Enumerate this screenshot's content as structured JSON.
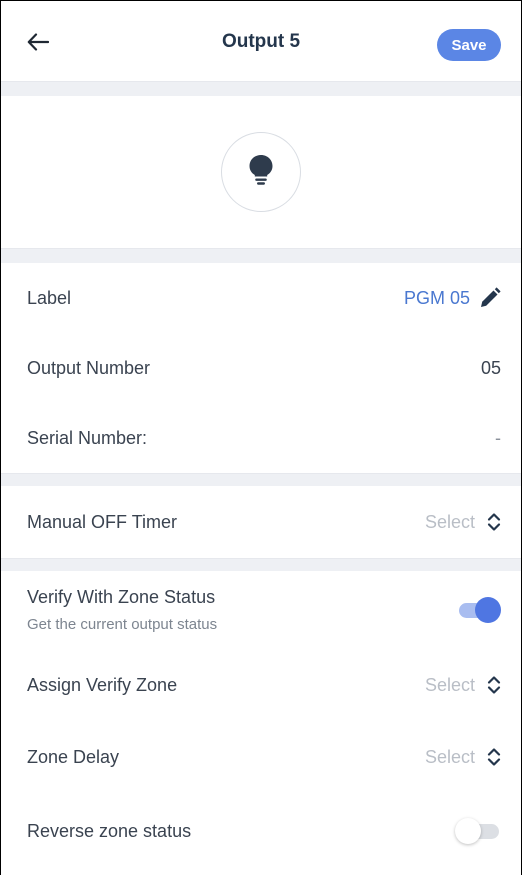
{
  "header": {
    "title": "Output 5",
    "save_label": "Save",
    "back_icon": "arrow-left-icon"
  },
  "output_icon": "lightbulb-icon",
  "fields": {
    "label": {
      "label": "Label",
      "value": "PGM 05",
      "icon": "pencil-icon"
    },
    "output_number": {
      "label": "Output Number",
      "value": "05"
    },
    "serial_number": {
      "label": "Serial Number:",
      "value": "-"
    },
    "manual_off_timer": {
      "label": "Manual OFF Timer",
      "value": "Select"
    },
    "verify_zone_status": {
      "label": "Verify With Zone Status",
      "sublabel": "Get the current output status",
      "enabled": true
    },
    "assign_verify_zone": {
      "label": "Assign Verify Zone",
      "value": "Select"
    },
    "zone_delay": {
      "label": "Zone Delay",
      "value": "Select"
    },
    "reverse_zone_status": {
      "label": "Reverse zone status",
      "enabled": false
    }
  },
  "colors": {
    "accent": "#5b86e5",
    "link": "#4a78d0",
    "muted": "#b9bec6",
    "toggle_on": "#4f76e2"
  }
}
